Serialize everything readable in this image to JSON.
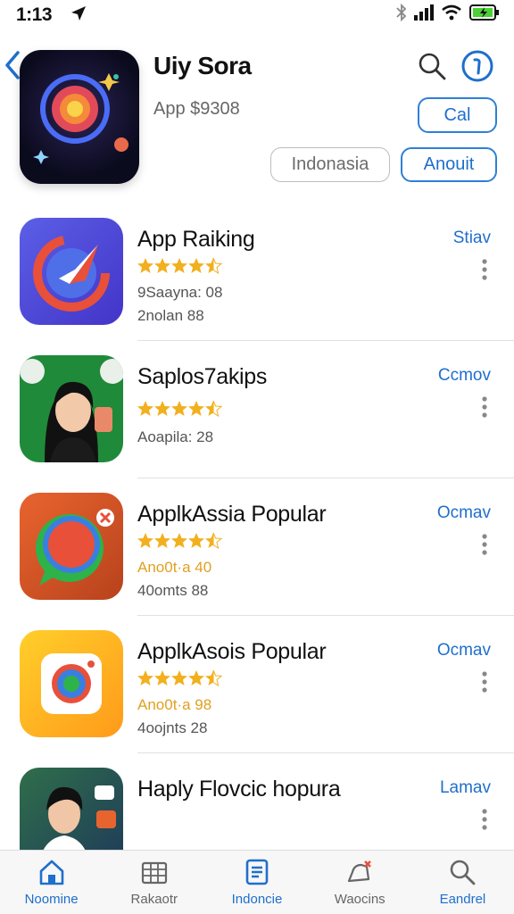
{
  "status_bar": {
    "time": "1:13"
  },
  "header": {
    "title": "Uiy Sora",
    "subtitle": "App $9308",
    "call_label": "Cal",
    "region_label": "Indonasia",
    "about_label": "Anouit"
  },
  "list": [
    {
      "name": "App Raiking",
      "action": "Stiav",
      "line1": "9Saayna: 08",
      "line2": "2nolan 88",
      "rating": 4.5
    },
    {
      "name": "Saplos7akips",
      "action": "Ccmov",
      "line1": "",
      "line2": "Aoapila: 28",
      "rating": 4.5
    },
    {
      "name": "ApplkAssia Popular",
      "action": "Ocmav",
      "line1": "Ano0t·a 40",
      "line2": "40omts 88",
      "rating": 4.5
    },
    {
      "name": "ApplkAsois Popular",
      "action": "Ocmav",
      "line1": "Ano0t·a 98",
      "line2": "4oojnts 28",
      "rating": 4.5
    },
    {
      "name": "Haply Flovcic hopura",
      "action": "Lamav",
      "line1": "",
      "line2": "",
      "rating": null
    }
  ],
  "tabs": [
    {
      "label": "Noomine",
      "icon": "home-icon"
    },
    {
      "label": "Rakaotr",
      "icon": "chart-icon"
    },
    {
      "label": "Indoncie",
      "icon": "document-icon"
    },
    {
      "label": "Waocins",
      "icon": "notification-icon"
    },
    {
      "label": "Eandrel",
      "icon": "search-icon"
    }
  ],
  "colors": {
    "accent": "#1f6fcc",
    "star": "#f2b01e",
    "divider": "#e1e1e1"
  }
}
